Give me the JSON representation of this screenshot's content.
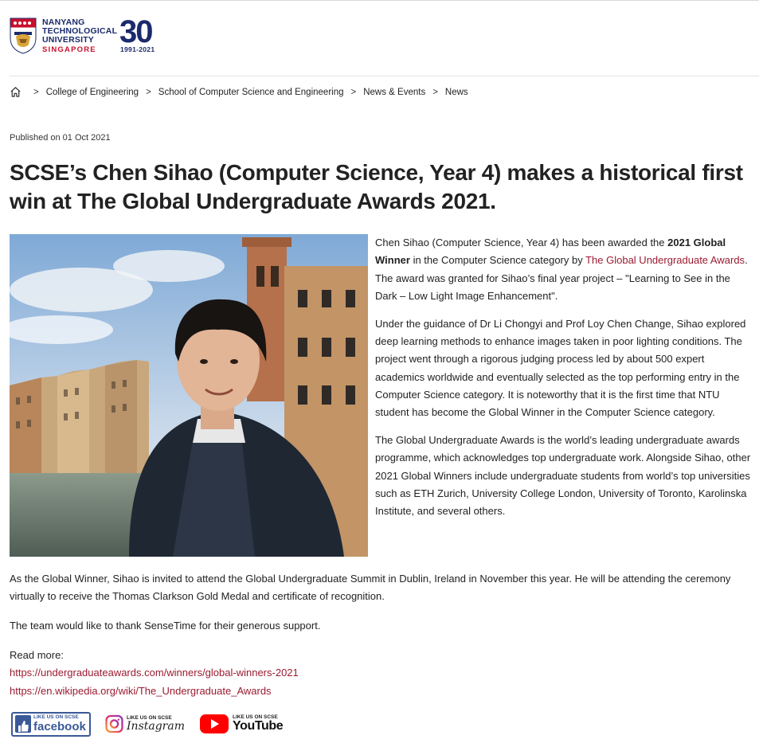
{
  "header": {
    "university_lines": [
      "NANYANG",
      "TECHNOLOGICAL",
      "UNIVERSITY"
    ],
    "university_country": "SINGAPORE",
    "anniversary_number": "30",
    "anniversary_years": "1991-2021"
  },
  "breadcrumb": {
    "items": [
      "College of Engineering",
      "School of Computer Science and Engineering",
      "News & Events",
      "News"
    ],
    "separator": ">"
  },
  "article": {
    "published": "Published on 01 Oct 2021",
    "title": "SCSE’s Chen Sihao (Computer Science, Year 4) makes a historical first win at The Global Undergraduate Awards 2021.",
    "p1": {
      "a": "Chen Sihao (Computer Science, Year 4) has been awarded the ",
      "bold": "2021 Global Winner",
      "b": " in the Computer Science category by ",
      "link": "The Global Undergraduate Awards",
      "c": ". The award was granted for Sihao’s final year project – \"Learning to See in the Dark – Low Light Image Enhancement\"."
    },
    "p2": "Under the guidance of Dr Li Chongyi and Prof Loy Chen Change, Sihao explored deep learning methods to enhance images taken in poor lighting conditions. The project went through a rigorous judging process led by about 500 expert academics worldwide and eventually selected as the top performing entry in the Computer Science category. It is noteworthy that it is the first time that NTU student has become the Global Winner in the Computer Science category.",
    "p3": "The Global Undergraduate Awards is the world’s leading undergraduate awards programme, which acknowledges top undergraduate work. Alongside Sihao, other 2021 Global Winners include undergraduate students from world’s top universities such as ETH Zurich, University College London, University of Toronto, Karolinska Institute, and  several others.",
    "p4": "As the Global Winner, Sihao is invited to attend the Global Undergraduate Summit in Dublin, Ireland in November this year. He will be attending the ceremony virtually to receive the Thomas Clarkson Gold Medal and certificate of recognition.",
    "p5": "The team would like to thank SenseTime for their generous support.",
    "read_more_label": "Read more:",
    "read_more_links": [
      "https://undergraduateawards.com/winners/global-winners-2021",
      "https://en.wikipedia.org/wiki/The_Undergraduate_Awards"
    ]
  },
  "social": {
    "facebook": {
      "small": "LIKE US ON SCSE",
      "big": "facebook"
    },
    "instagram": {
      "small": "LIKE US ON SCSE",
      "big": "Instagram"
    },
    "youtube": {
      "small": "LIKE US ON SCSE",
      "big": "YouTube"
    }
  },
  "colors": {
    "link": "#9b1b30",
    "ntu_blue": "#1b2a6b",
    "ntu_red": "#c8102e",
    "facebook": "#3b5998",
    "youtube": "#ff0000"
  },
  "icons": [
    "ntu-crest-icon",
    "home-icon",
    "facebook-thumb-icon",
    "instagram-icon",
    "youtube-play-icon"
  ]
}
